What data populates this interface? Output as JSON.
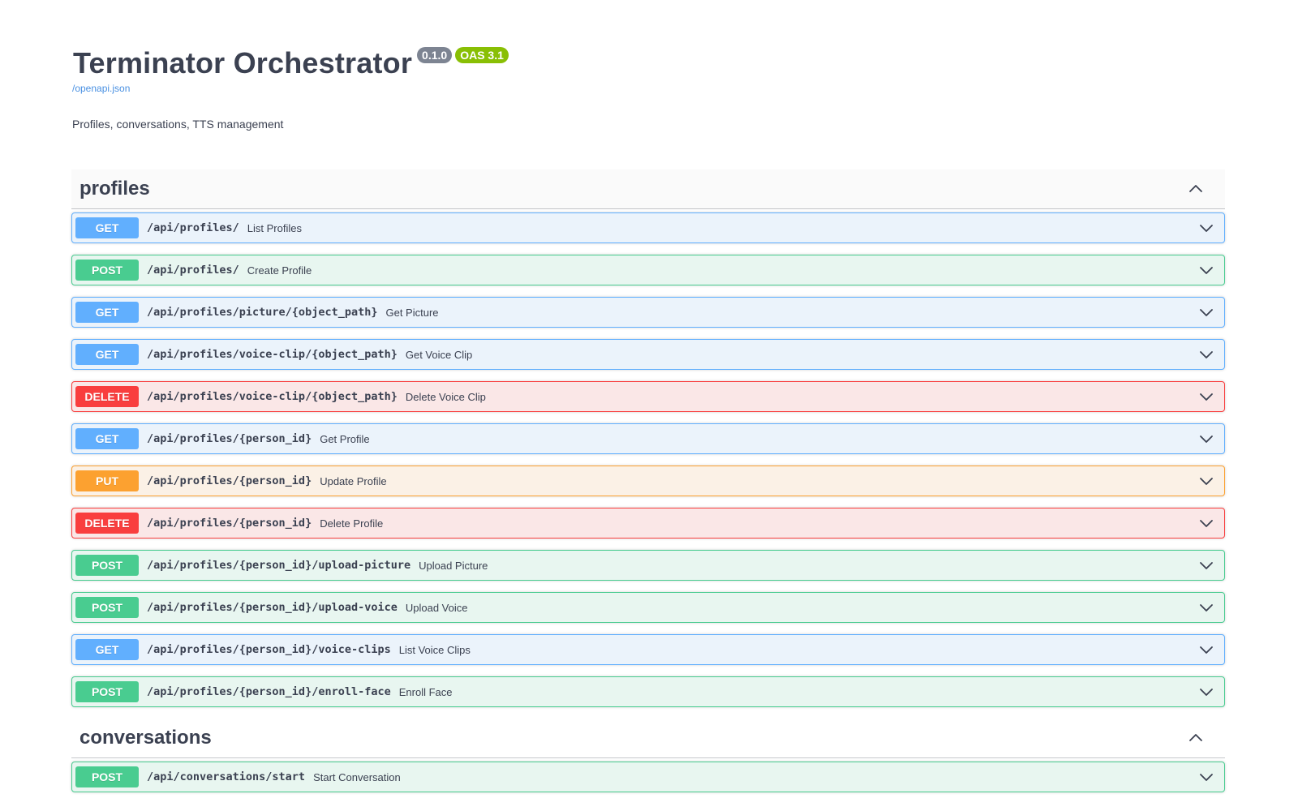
{
  "info": {
    "title": "Terminator Orchestrator",
    "version": "0.1.0",
    "oas": "OAS 3.1",
    "spec_link": "/openapi.json",
    "description": "Profiles, conversations, TTS management"
  },
  "colors": {
    "GET": {
      "bg": "#ebf3fb",
      "border": "#61affe",
      "badge": "#61affe"
    },
    "POST": {
      "bg": "#e8f6f0",
      "border": "#49cc90",
      "badge": "#49cc90"
    },
    "PUT": {
      "bg": "#fbf1e6",
      "border": "#fca130",
      "badge": "#fca130"
    },
    "DELETE": {
      "bg": "#fae7e7",
      "border": "#f93e3e",
      "badge": "#f93e3e"
    }
  },
  "tags": [
    {
      "name": "profiles",
      "operations": [
        {
          "method": "GET",
          "path": "/api/profiles/",
          "summary": "List Profiles"
        },
        {
          "method": "POST",
          "path": "/api/profiles/",
          "summary": "Create Profile"
        },
        {
          "method": "GET",
          "path": "/api/profiles/picture/{object_path}",
          "summary": "Get Picture"
        },
        {
          "method": "GET",
          "path": "/api/profiles/voice-clip/{object_path}",
          "summary": "Get Voice Clip"
        },
        {
          "method": "DELETE",
          "path": "/api/profiles/voice-clip/{object_path}",
          "summary": "Delete Voice Clip"
        },
        {
          "method": "GET",
          "path": "/api/profiles/{person_id}",
          "summary": "Get Profile"
        },
        {
          "method": "PUT",
          "path": "/api/profiles/{person_id}",
          "summary": "Update Profile"
        },
        {
          "method": "DELETE",
          "path": "/api/profiles/{person_id}",
          "summary": "Delete Profile"
        },
        {
          "method": "POST",
          "path": "/api/profiles/{person_id}/upload-picture",
          "summary": "Upload Picture"
        },
        {
          "method": "POST",
          "path": "/api/profiles/{person_id}/upload-voice",
          "summary": "Upload Voice"
        },
        {
          "method": "GET",
          "path": "/api/profiles/{person_id}/voice-clips",
          "summary": "List Voice Clips"
        },
        {
          "method": "POST",
          "path": "/api/profiles/{person_id}/enroll-face",
          "summary": "Enroll Face"
        }
      ]
    },
    {
      "name": "conversations",
      "operations": [
        {
          "method": "POST",
          "path": "/api/conversations/start",
          "summary": "Start Conversation"
        }
      ]
    }
  ]
}
